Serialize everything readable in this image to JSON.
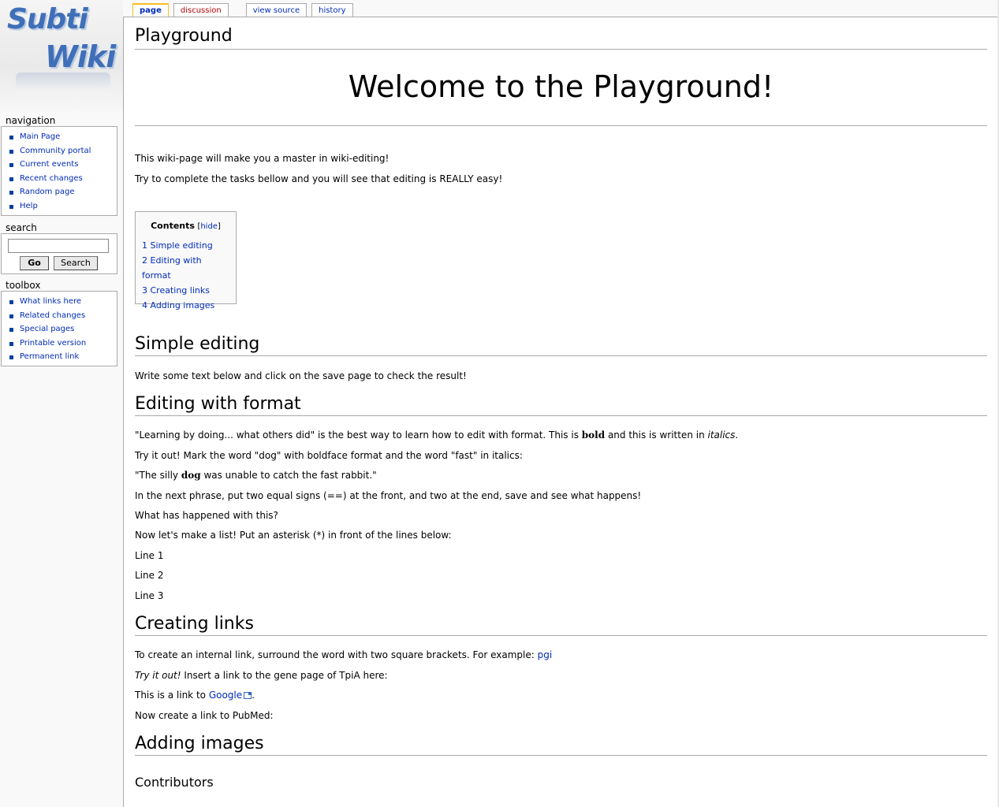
{
  "logo": {
    "line1": "Subti",
    "line2": "Wiki"
  },
  "tabs": {
    "page": "page",
    "discussion": "discussion",
    "view_source": "view source",
    "history": "history"
  },
  "navigation": {
    "title": "navigation",
    "items": [
      "Main Page",
      "Community portal",
      "Current events",
      "Recent changes",
      "Random page",
      "Help"
    ]
  },
  "search": {
    "title": "search",
    "input_value": "",
    "go_label": "Go",
    "search_label": "Search"
  },
  "toolbox": {
    "title": "toolbox",
    "items": [
      "What links here",
      "Related changes",
      "Special pages",
      "Printable version",
      "Permanent link"
    ]
  },
  "page": {
    "title": "Playground",
    "welcome": "Welcome to the Playground!",
    "intro1": "This wiki-page will make you a master in wiki-editing!",
    "intro2": "Try to complete the tasks bellow and you will see that editing is REALLY easy!"
  },
  "toc": {
    "title": "Contents",
    "hide_open": "[",
    "hide": "hide",
    "hide_close": "]",
    "items": [
      "1 Simple editing",
      "2 Editing with format",
      "3 Creating links",
      "4 Adding images"
    ]
  },
  "sections": {
    "simple": {
      "heading": "Simple editing",
      "text": "Write some text below and click on the save page to check the result!"
    },
    "format": {
      "heading": "Editing with format",
      "p1_a": "\"Learning by doing... what others did\" is the best way to learn how to edit with format. This is ",
      "p1_bold": "bold",
      "p1_b": " and this is written in ",
      "p1_italic": "italics",
      "p1_c": ".",
      "p2": "Try it out! Mark the word \"dog\" with boldface format and the word \"fast\" in italics:",
      "p3_a": "\"The silly ",
      "p3_bold": "dog",
      "p3_b": " was unable to catch the fast rabbit.\"",
      "p4": "In the next phrase, put two equal signs (==) at the front, and two at the end, save and see what happens!",
      "p5": "What has happened with this?",
      "p6": "Now let's make a list! Put an asterisk (*) in front of the lines below:",
      "line1": "Line 1",
      "line2": "Line 2",
      "line3": "Line 3"
    },
    "links": {
      "heading": "Creating links",
      "p1_a": "To create an internal link, surround the word with two square brackets. For example: ",
      "p1_link": "pgi",
      "p2_italic": "Try it out!",
      "p2_b": " Insert a link to the gene page of TpiA here:",
      "p3_a": "This is a link to ",
      "p3_link": "Google",
      "p3_b": ".",
      "p4": "Now create a link to PubMed:"
    },
    "images": {
      "heading": "Adding images"
    },
    "contributors": {
      "heading": "Contributors"
    }
  },
  "colors": {
    "link": "#002bb8",
    "new_link": "#ba0000",
    "selected_tab_border": "#fabd23",
    "border": "#aaaaaa"
  }
}
